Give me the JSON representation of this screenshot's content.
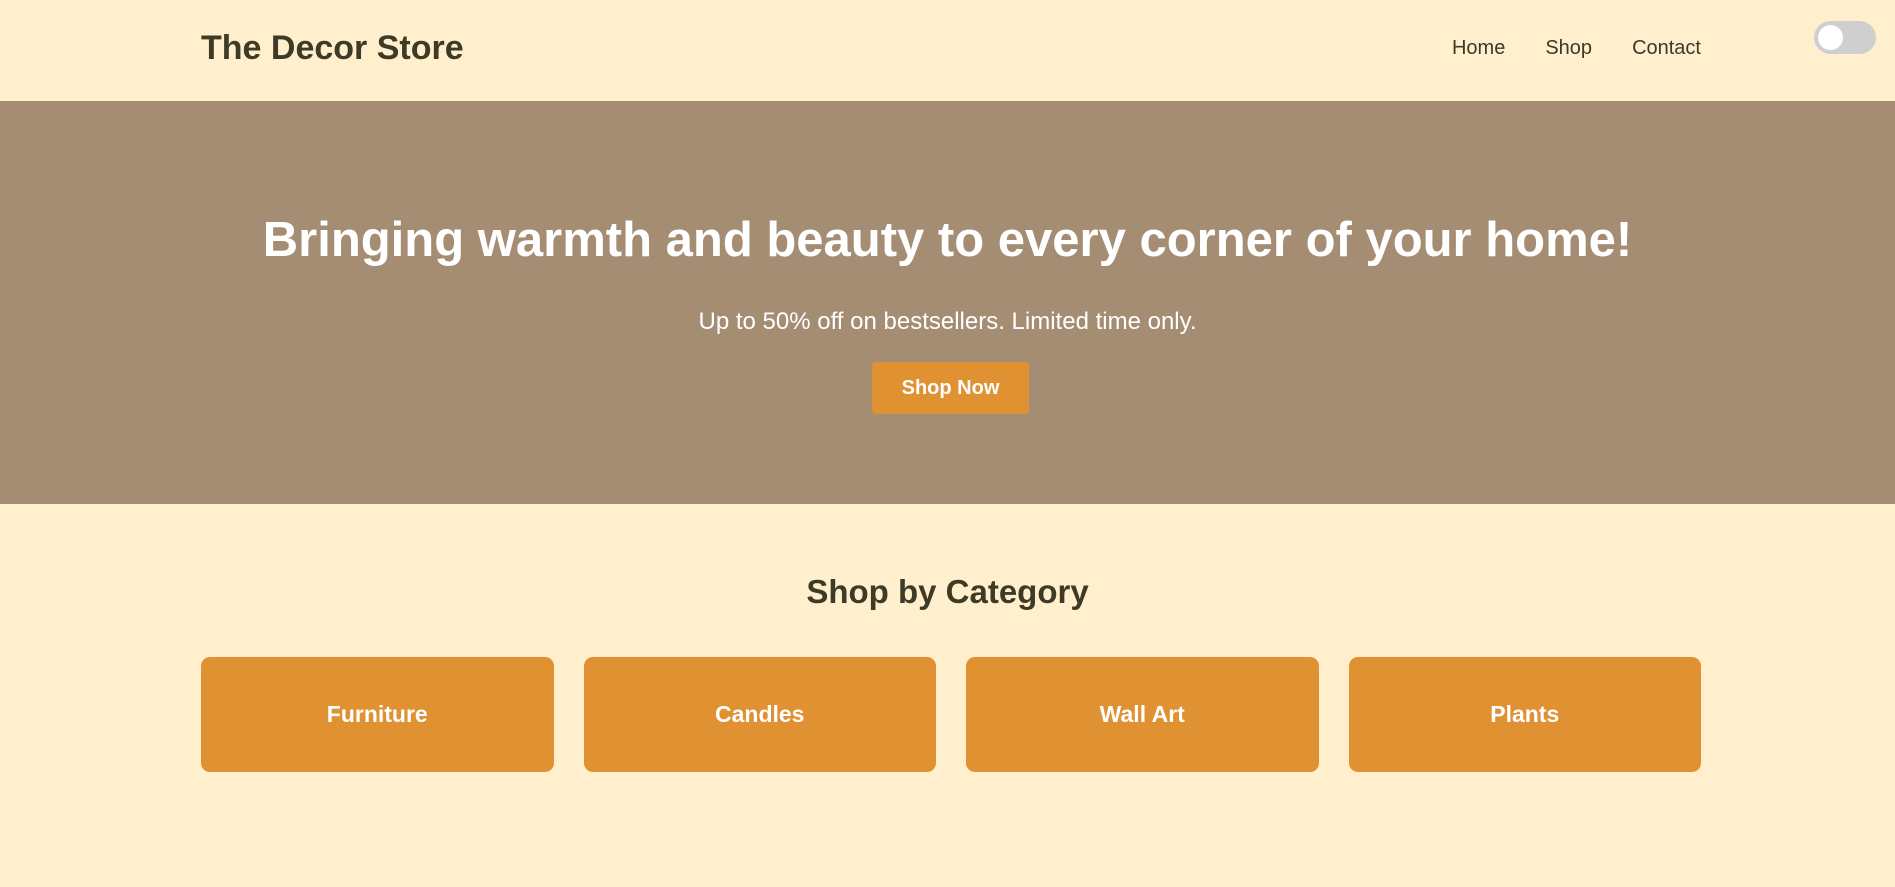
{
  "header": {
    "brand": "The Decor Store",
    "nav": [
      "Home",
      "Shop",
      "Contact"
    ],
    "theme_toggle": {
      "icon": "toggle-switch",
      "state": "off"
    }
  },
  "hero": {
    "title": "Bringing warmth and beauty to every corner of your home!",
    "subtitle": "Up to 50% off on bestsellers. Limited time only.",
    "cta_label": "Shop Now"
  },
  "categories": {
    "title": "Shop by Category",
    "items": [
      "Furniture",
      "Candles",
      "Wall Art",
      "Plants"
    ]
  },
  "colors": {
    "background": "#ffefcd",
    "hero_background": "#a58d73",
    "accent": "#e09132",
    "text_dark": "#3d3a26",
    "text_light": "#ffffff"
  }
}
